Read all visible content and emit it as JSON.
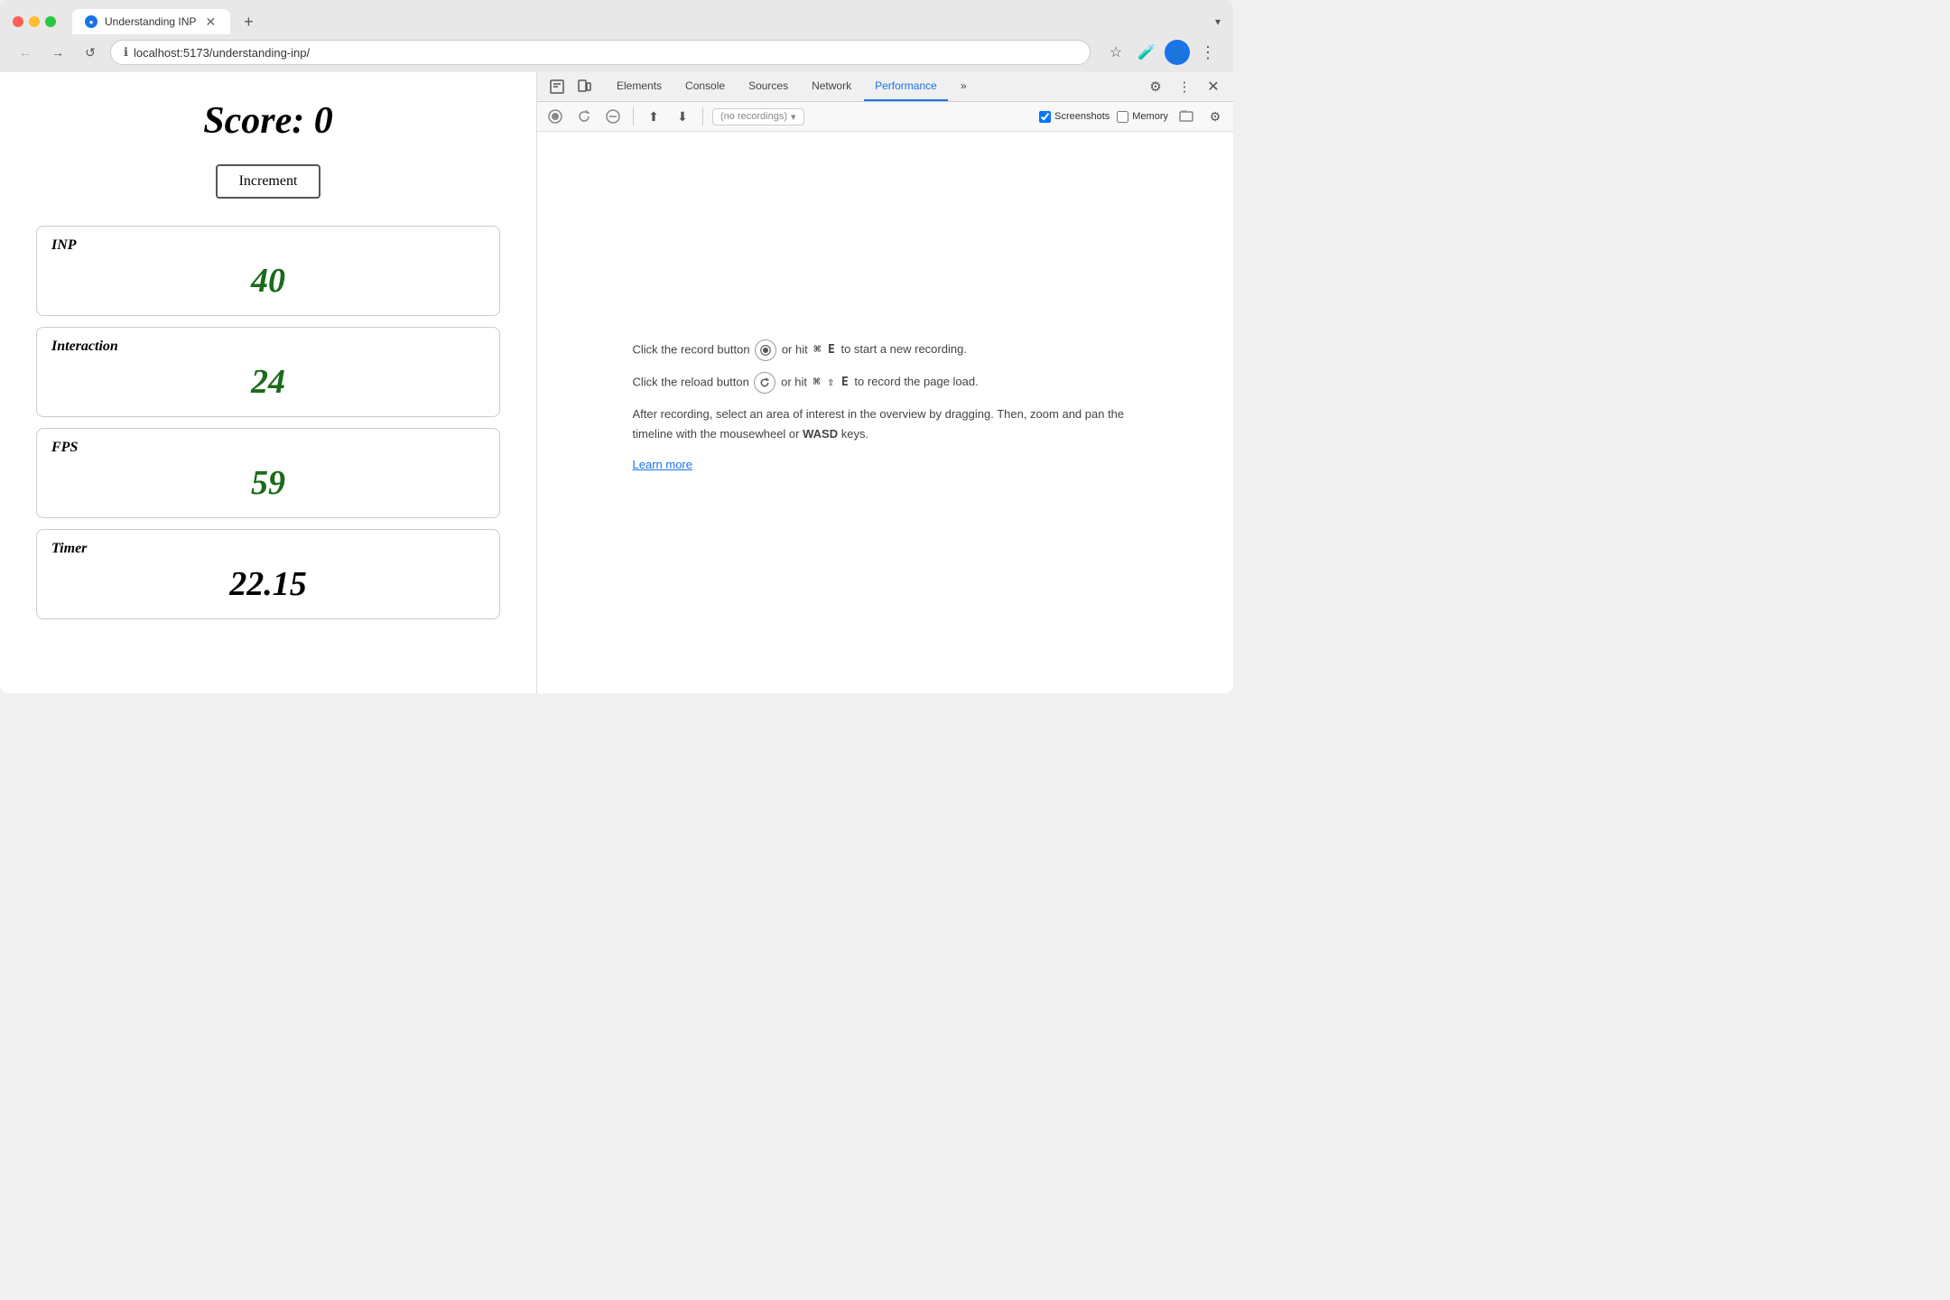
{
  "browser": {
    "tab_title": "Understanding INP",
    "url": "localhost:5173/understanding-inp/",
    "new_tab_label": "+",
    "tab_dropdown_label": "▾"
  },
  "nav": {
    "back_label": "←",
    "forward_label": "→",
    "reload_label": "↺",
    "secure_icon": "🔒"
  },
  "browser_actions": {
    "bookmark_label": "☆",
    "extension_label": "🧪",
    "profile_label": "👤",
    "menu_label": "⋮"
  },
  "webpage": {
    "score_label": "Score:",
    "score_value": "0",
    "increment_btn": "Increment",
    "metrics": [
      {
        "label": "INP",
        "value": "40",
        "is_timer": false
      },
      {
        "label": "Interaction",
        "value": "24",
        "is_timer": false
      },
      {
        "label": "FPS",
        "value": "59",
        "is_timer": false
      },
      {
        "label": "Timer",
        "value": "22.15",
        "is_timer": true
      }
    ]
  },
  "devtools": {
    "tabs": [
      {
        "label": "Elements",
        "active": false
      },
      {
        "label": "Console",
        "active": false
      },
      {
        "label": "Sources",
        "active": false
      },
      {
        "label": "Network",
        "active": false
      },
      {
        "label": "Performance",
        "active": true
      },
      {
        "label": "»",
        "active": false
      }
    ],
    "toolbar": {
      "record_label": "⏺",
      "reload_label": "↺",
      "clear_label": "🚫",
      "upload_label": "⬆",
      "download_label": "⬇",
      "recordings_placeholder": "(no recordings)",
      "screenshots_label": "Screenshots",
      "memory_label": "Memory",
      "settings_label": "⚙",
      "more_label": "⋮",
      "close_label": "✕",
      "settings2_label": "⚙"
    },
    "instructions": {
      "line1_prefix": "Click the record button",
      "record_icon": "⏺",
      "line1_suffix": "or hit",
      "line1_shortcut": "⌘ E",
      "line1_end": "to start a new recording.",
      "line2_prefix": "Click the reload button",
      "reload_icon": "↺",
      "line2_suffix": "or hit",
      "line2_shortcut": "⌘ ⇧ E",
      "line2_end": "to record the page load.",
      "line3": "After recording, select an area of interest in the overview by dragging. Then, zoom and pan the timeline with the mousewheel or",
      "line3_bold": "WASD",
      "line3_end": "keys.",
      "learn_more": "Learn more"
    }
  }
}
